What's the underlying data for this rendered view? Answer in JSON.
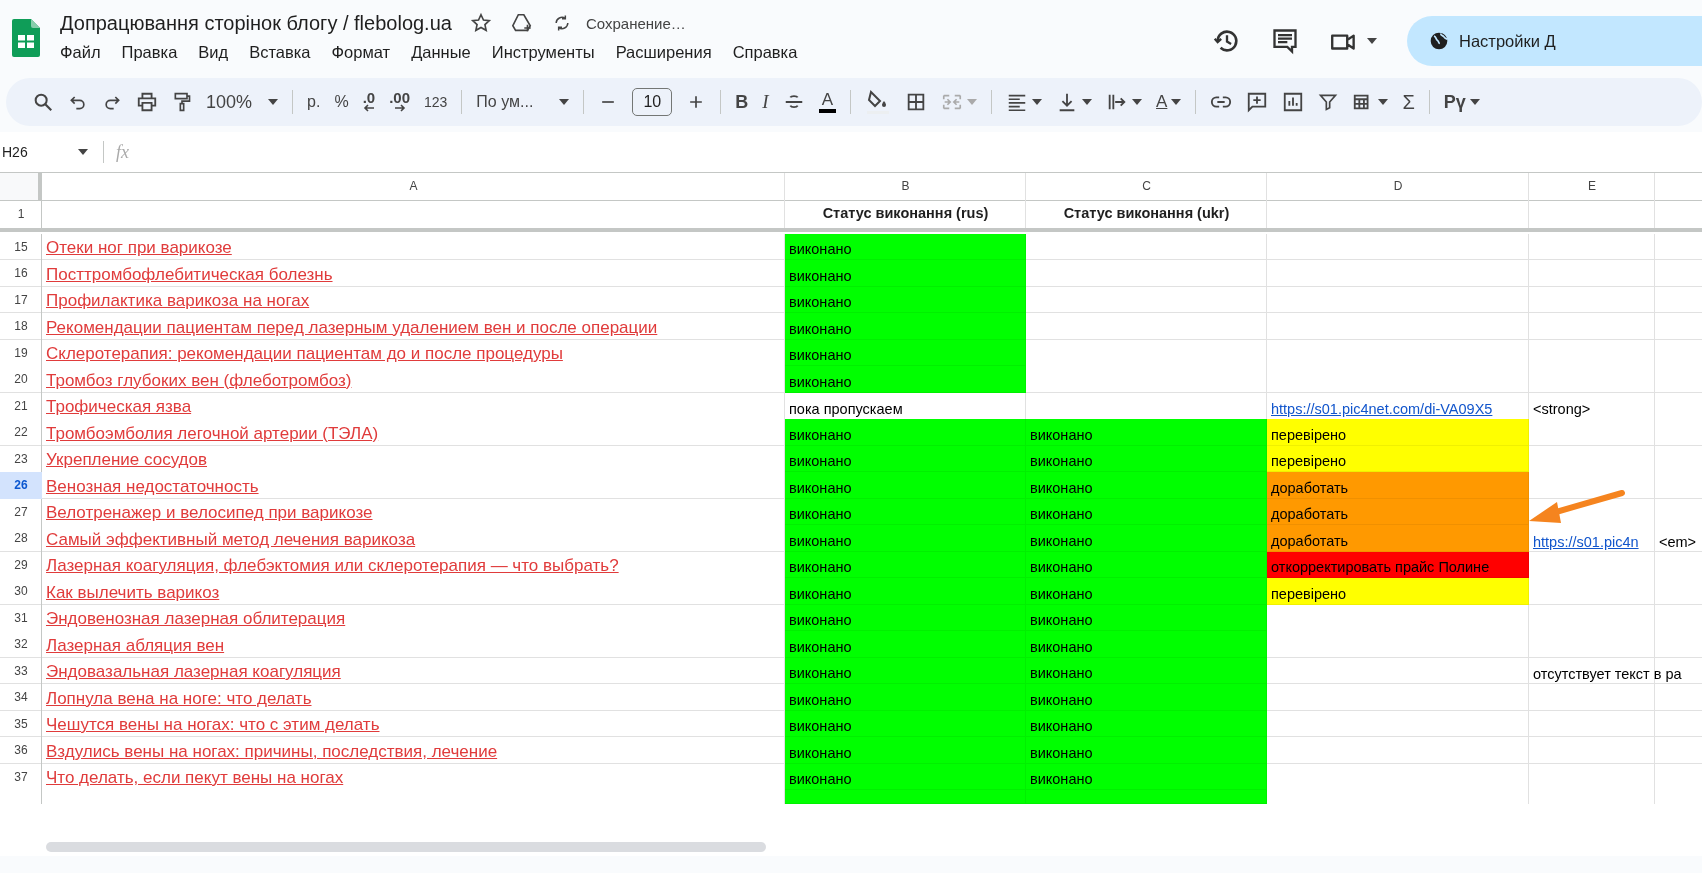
{
  "header": {
    "title": "Допрацювання сторінок блогу / flebolog.ua",
    "save_status": "Сохранение…",
    "menu": [
      "Файл",
      "Правка",
      "Вид",
      "Вставка",
      "Формат",
      "Данные",
      "Инструменты",
      "Расширения",
      "Справка"
    ],
    "share_button": "Настройки Д"
  },
  "toolbar": {
    "zoom": "100%",
    "currency": "р.",
    "percent": "%",
    "decrease_decimals": ".0",
    "increase_decimals": ".00",
    "more_formats": "123",
    "font": "По ум...",
    "font_size": "10",
    "bold": "B",
    "italic": "I",
    "text_color": "A",
    "rotate": "A",
    "functions": "Σ",
    "input_tools": "Рү"
  },
  "formula_bar": {
    "cell_ref": "H26",
    "fx": "fx"
  },
  "columns": [
    "A",
    "B",
    "C",
    "D",
    "E"
  ],
  "header_row": {
    "num": "1",
    "B": {
      "kind": "text",
      "text": "Статус виконання (rus)"
    },
    "C": {
      "kind": "text",
      "text": "Статус виконання (ukr)"
    }
  },
  "rows": [
    {
      "num": "15",
      "selected": false,
      "A": {
        "kind": "link",
        "text": "Отеки ног при варикозе"
      },
      "B": {
        "kind": "text",
        "text": "виконано",
        "color": "#00ff00"
      }
    },
    {
      "num": "16",
      "selected": false,
      "A": {
        "kind": "link",
        "text": "Посттромбофлебитическая болезнь"
      },
      "B": {
        "kind": "text",
        "text": "виконано",
        "color": "#00ff00"
      }
    },
    {
      "num": "17",
      "selected": false,
      "A": {
        "kind": "link",
        "text": "Профилактика варикоза на ногах"
      },
      "B": {
        "kind": "text",
        "text": "виконано",
        "color": "#00ff00"
      }
    },
    {
      "num": "18",
      "selected": false,
      "A": {
        "kind": "link",
        "text": "Рекомендации пациентам перед лазерным удалением вен и после операции"
      },
      "B": {
        "kind": "text",
        "text": "виконано",
        "color": "#00ff00"
      }
    },
    {
      "num": "19",
      "selected": false,
      "A": {
        "kind": "link",
        "text": "Склеротерапия: рекомендации пациентам до и после процедуры"
      },
      "B": {
        "kind": "text",
        "text": "виконано",
        "color": "#00ff00"
      }
    },
    {
      "num": "20",
      "selected": false,
      "A": {
        "kind": "link",
        "text": "Тромбоз глубоких вен (флеботромбоз)"
      },
      "B": {
        "kind": "text",
        "text": "виконано",
        "color": "#00ff00"
      }
    },
    {
      "num": "21",
      "selected": false,
      "A": {
        "kind": "link",
        "text": "Трофическая язва"
      },
      "B": {
        "kind": "text",
        "text": "пока пропускаем"
      },
      "D": {
        "kind": "url",
        "text": "https://s01.pic4net.com/di-VA09X5"
      },
      "E": {
        "kind": "text",
        "text": "<strong>"
      }
    },
    {
      "num": "22",
      "selected": false,
      "A": {
        "kind": "link",
        "text": "Тромбоэмболия легочной артерии (ТЭЛА)"
      },
      "B": {
        "kind": "text",
        "text": "виконано",
        "color": "#00ff00"
      },
      "C": {
        "kind": "text",
        "text": "виконано",
        "color": "#00ff00"
      },
      "D": {
        "kind": "text",
        "text": "перевірено",
        "color": "#ffff00"
      }
    },
    {
      "num": "23",
      "selected": false,
      "A": {
        "kind": "link",
        "text": "Укрепление сосудов"
      },
      "B": {
        "kind": "text",
        "text": "виконано",
        "color": "#00ff00"
      },
      "C": {
        "kind": "text",
        "text": "виконано",
        "color": "#00ff00"
      },
      "D": {
        "kind": "text",
        "text": "перевірено",
        "color": "#ffff00"
      }
    },
    {
      "num": "26",
      "selected": true,
      "A": {
        "kind": "link",
        "text": "Венозная недостаточность"
      },
      "B": {
        "kind": "text",
        "text": "виконано",
        "color": "#00ff00"
      },
      "C": {
        "kind": "text",
        "text": "виконано",
        "color": "#00ff00"
      },
      "D": {
        "kind": "text",
        "text": "доработать",
        "color": "#ff9900"
      }
    },
    {
      "num": "27",
      "selected": false,
      "A": {
        "kind": "link",
        "text": "Велотренажер и велосипед при варикозе"
      },
      "B": {
        "kind": "text",
        "text": "виконано",
        "color": "#00ff00"
      },
      "C": {
        "kind": "text",
        "text": "виконано",
        "color": "#00ff00"
      },
      "D": {
        "kind": "text",
        "text": "доработать",
        "color": "#ff9900"
      }
    },
    {
      "num": "28",
      "selected": false,
      "A": {
        "kind": "link",
        "text": "Самый эффективный метод лечения варикоза"
      },
      "B": {
        "kind": "text",
        "text": "виконано",
        "color": "#00ff00"
      },
      "C": {
        "kind": "text",
        "text": "виконано",
        "color": "#00ff00"
      },
      "D": {
        "kind": "text",
        "text": "доработать",
        "color": "#ff9900"
      },
      "E": {
        "kind": "url",
        "text": "https://s01.pic4n"
      },
      "F": {
        "kind": "text",
        "text": "<em>"
      }
    },
    {
      "num": "29",
      "selected": false,
      "A": {
        "kind": "link",
        "text": "Лазерная коагуляция, флебэктомия или склеротерапия — что выбрать?"
      },
      "B": {
        "kind": "text",
        "text": "виконано",
        "color": "#00ff00"
      },
      "C": {
        "kind": "text",
        "text": "виконано",
        "color": "#00ff00"
      },
      "D": {
        "kind": "text",
        "text": "откорректировать прайс Полине",
        "color": "#ff0000"
      }
    },
    {
      "num": "30",
      "selected": false,
      "A": {
        "kind": "link",
        "text": "Как вылечить варикоз"
      },
      "B": {
        "kind": "text",
        "text": "виконано",
        "color": "#00ff00"
      },
      "C": {
        "kind": "text",
        "text": "виконано",
        "color": "#00ff00"
      },
      "D": {
        "kind": "text",
        "text": "перевірено",
        "color": "#ffff00"
      }
    },
    {
      "num": "31",
      "selected": false,
      "A": {
        "kind": "link",
        "text": "Эндовенозная лазерная облитерация"
      },
      "B": {
        "kind": "text",
        "text": "виконано",
        "color": "#00ff00"
      },
      "C": {
        "kind": "text",
        "text": "виконано",
        "color": "#00ff00"
      }
    },
    {
      "num": "32",
      "selected": false,
      "A": {
        "kind": "link",
        "text": "Лазерная абляция вен"
      },
      "B": {
        "kind": "text",
        "text": "виконано",
        "color": "#00ff00"
      },
      "C": {
        "kind": "text",
        "text": "виконано",
        "color": "#00ff00"
      }
    },
    {
      "num": "33",
      "selected": false,
      "A": {
        "kind": "link",
        "text": "Эндовазальная лазерная коагуляция"
      },
      "B": {
        "kind": "text",
        "text": "виконано",
        "color": "#00ff00"
      },
      "C": {
        "kind": "text",
        "text": "виконано",
        "color": "#00ff00"
      },
      "E": {
        "kind": "text",
        "text": "отсутствует текст в ра"
      }
    },
    {
      "num": "34",
      "selected": false,
      "A": {
        "kind": "link",
        "text": "Лопнула вена на ноге: что делать"
      },
      "B": {
        "kind": "text",
        "text": "виконано",
        "color": "#00ff00"
      },
      "C": {
        "kind": "text",
        "text": "виконано",
        "color": "#00ff00"
      }
    },
    {
      "num": "35",
      "selected": false,
      "A": {
        "kind": "link",
        "text": "Чешутся вены на ногах: что с этим делать"
      },
      "B": {
        "kind": "text",
        "text": "виконано",
        "color": "#00ff00"
      },
      "C": {
        "kind": "text",
        "text": "виконано",
        "color": "#00ff00"
      }
    },
    {
      "num": "36",
      "selected": false,
      "A": {
        "kind": "link",
        "text": "Вздулись вены на ногах: причины, последствия, лечение"
      },
      "B": {
        "kind": "text",
        "text": "виконано",
        "color": "#00ff00"
      },
      "C": {
        "kind": "text",
        "text": "виконано",
        "color": "#00ff00"
      }
    },
    {
      "num": "37",
      "selected": false,
      "A": {
        "kind": "link",
        "text": "Что делать, если пекут вены на ногах"
      },
      "B": {
        "kind": "text",
        "text": "виконано",
        "color": "#00ff00"
      },
      "C": {
        "kind": "text",
        "text": "виконано",
        "color": "#00ff00"
      }
    }
  ]
}
